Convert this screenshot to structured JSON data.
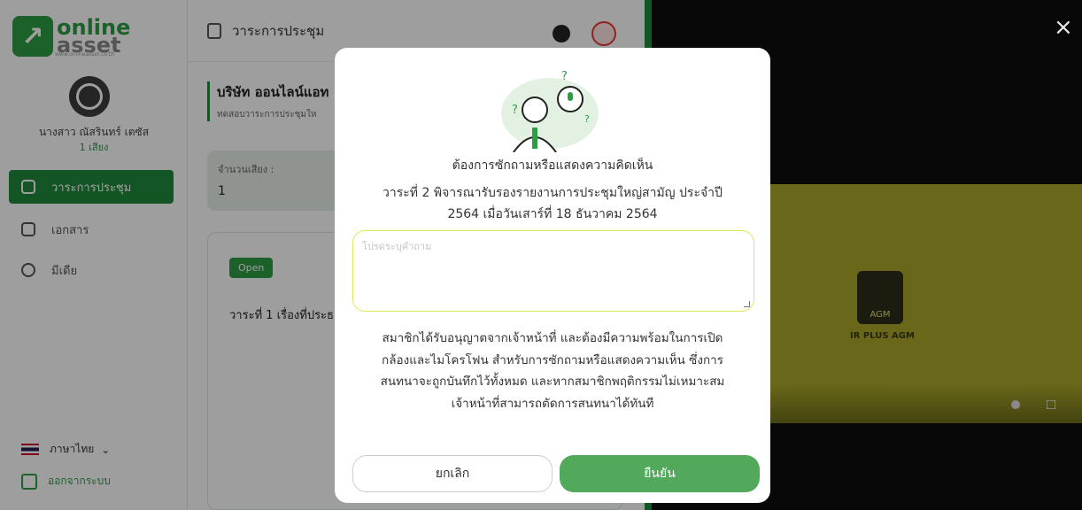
{
  "brand": {
    "line1": "online",
    "line2": "asset",
    "tagline": "www.onlineasset.co.th",
    "accent": "#2e9d45"
  },
  "user": {
    "name": "นางสาว ณัสรินทร์ เตซัส",
    "votes": "1 เสียง"
  },
  "sidebar": {
    "items": [
      {
        "label": "วาระการประชุม",
        "icon": "agenda-icon",
        "active": true
      },
      {
        "label": "เอกสาร",
        "icon": "folder-icon",
        "active": false
      },
      {
        "label": "มีเดีย",
        "icon": "play-icon",
        "active": false
      }
    ],
    "language": "ภาษาไทย",
    "logout": "ออกจากระบบ"
  },
  "header": {
    "title": "วาระการประชุม"
  },
  "main": {
    "company": "บริษัท ออนไลน์แอท",
    "company_sub": "ทดสอบวาระการประชุมให",
    "votes_label": "จำนวนเสียง :",
    "votes_value": "1",
    "status_badge": "Open",
    "agenda_item": "วาระที่ 1 เรื่องที่ประธ"
  },
  "video": {
    "caption": "IR PLUS AGM",
    "logo_text": "AGM"
  },
  "modal": {
    "title": "ต้องการซักถามหรือแสดงความคิดเห็น",
    "agenda_line1": "วาระที่ 2 พิจารณารับรองรายงานการประชุมใหญ่สามัญ ประจำปี",
    "agenda_line2": "2564 เมื่อวันเสาร์ที่ 18 ธันวาคม 2564",
    "question_placeholder": "โปรดระบุคำถาม",
    "question_value": "",
    "notice_line1": "สมาชิกได้รับอนุญาตจากเจ้าหน้าที่ และต้องมีความพร้อมในการเปิด",
    "notice_line2": "กล้องและไมโครโฟน สำหรับการซักถามหรือแสดงความเห็น ซึ่งการ",
    "notice_line3": "สนทนาจะถูกบันทึกไว้ทั้งหมด และหากสมาชิกพฤติกรรมไม่เหมาะสม",
    "notice_line4": "เจ้าหน้าที่สามารถตัดการสนทนาได้ทันที",
    "cancel_label": "ยกเลิก",
    "confirm_label": "ยืนยัน",
    "confirm_color": "#52a95b"
  },
  "overlay": {
    "close_symbol": "×"
  }
}
